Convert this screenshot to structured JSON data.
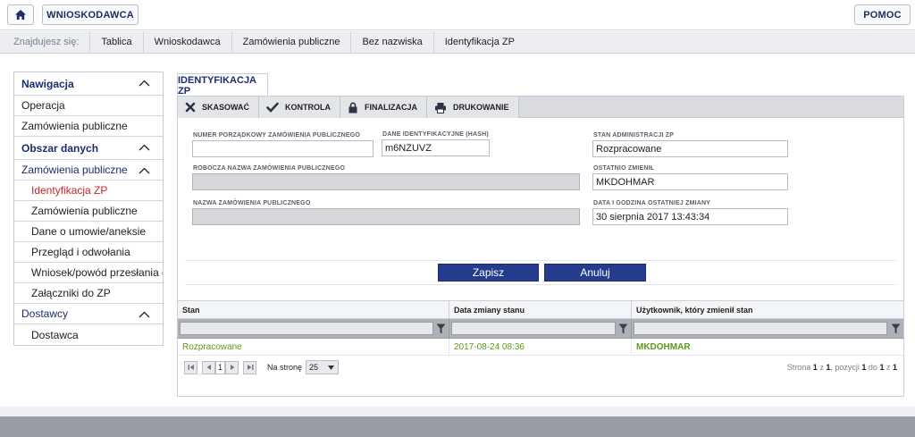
{
  "topbar": {
    "wnioskodawca_label": "WNIOSKODAWCA",
    "pomoc_label": "POMOC",
    "home_icon": "home-icon"
  },
  "breadcrumb": {
    "label": "Znajdujesz się:",
    "items": [
      "Tablica",
      "Wnioskodawca",
      "Zamówienia publiczne",
      "Bez nazwiska",
      "Identyfikacja ZP"
    ]
  },
  "sidebar": {
    "nawigacja": "Nawigacja",
    "operacja": "Operacja",
    "zamowienia_publiczne": "Zamówienia publiczne",
    "obszar_danych": "Obszar danych",
    "zamowienia_publiczne_group": "Zamówienia publiczne",
    "children": [
      "Identyfikacja ZP",
      "Zamówienia publiczne",
      "Dane o umowie/aneksie",
      "Przegląd i odwołania",
      "Wniosek/powód przesłania do UOK",
      "Załączniki do ZP"
    ],
    "dostawcy": "Dostawcy",
    "dostawca": "Dostawca"
  },
  "tab": {
    "label": "IDENTYFIKACJA ZP"
  },
  "toolbar": {
    "skasowac": "SKASOWAĆ",
    "kontrola": "KONTROLA",
    "finalizacja": "FINALIZACJA",
    "drukowanie": "DRUKOWANIE"
  },
  "form": {
    "numer_label": "NUMER PORZĄDKOWY ZAMÓWIENIA PUBLICZNEGO",
    "numer_value": "",
    "dane_label": "DANE IDENTYFIKACYJNE (HASH)",
    "dane_value": "m6NZUVZ",
    "stan_label": "STAN ADMINISTRACJI ZP",
    "stan_value": "Rozpracowane",
    "robocza_label": "ROBOCZA NAZWA ZAMÓWIENIA PUBLICZNEGO",
    "robocza_value": "",
    "ostatnio_label": "OSTATNIO ZMIENIŁ",
    "ostatnio_value": "MKDOHMAR",
    "nazwa_label": "NAZWA ZAMÓWIENIA PUBLICZNEGO",
    "nazwa_value": "",
    "data_label": "DATA I GODZINA OSTATNIEJ ZMIANY",
    "data_value": "30 sierpnia 2017 13:43:34",
    "zapisz": "Zapisz",
    "anuluj": "Anuluj"
  },
  "grid": {
    "headers": [
      "Stan",
      "Data zmiany stanu",
      "Użytkownik, który zmienił stan"
    ],
    "rows": [
      [
        "Rozpracowane",
        "2017-08-24 08:36",
        "MKDOHMAR"
      ]
    ]
  },
  "pager": {
    "page": "1",
    "na_stronie": "Na stronę",
    "page_size": "25",
    "info_strona": "Strona",
    "info_page": "1",
    "info_z": "z",
    "info_total_pages": "1",
    "info_pozycji": ", pozycji",
    "info_from": "1",
    "info_do": "do",
    "info_to": "1",
    "info_z2": "z",
    "info_total": "1"
  },
  "colors": {
    "accent": "#1c2d6b",
    "button": "#253c8e",
    "active": "#c0262d",
    "green": "#5a9a1a"
  }
}
